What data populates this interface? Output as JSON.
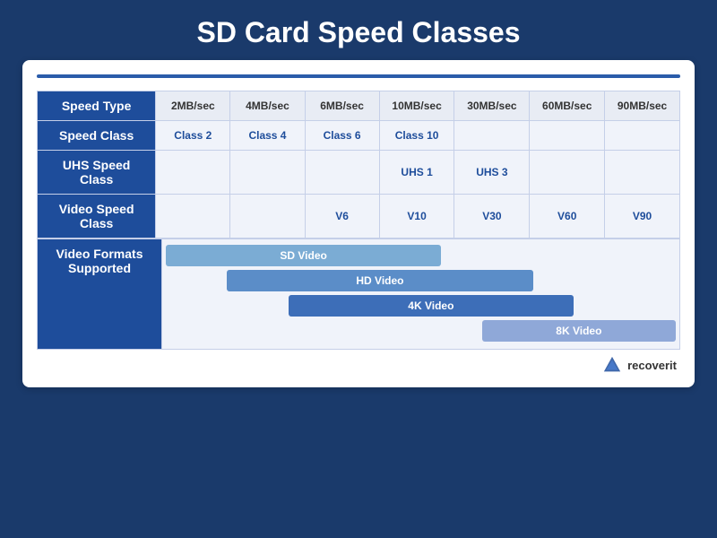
{
  "title": "SD Card Speed Classes",
  "table": {
    "header": {
      "label": "Speed Type",
      "cols": [
        "2MB/sec",
        "4MB/sec",
        "6MB/sec",
        "10MB/sec",
        "30MB/sec",
        "60MB/sec",
        "90MB/sec"
      ]
    },
    "rows": [
      {
        "label": "Speed Class",
        "cells": [
          "Class 2",
          "Class 4",
          "Class 6",
          "Class 10",
          "",
          "",
          ""
        ]
      },
      {
        "label": "UHS Speed Class",
        "cells": [
          "",
          "",
          "",
          "UHS 1",
          "UHS 3",
          "",
          ""
        ]
      },
      {
        "label": "Video Speed Class",
        "cells": [
          "",
          "",
          "V6",
          "V10",
          "V30",
          "V60",
          "V90"
        ]
      }
    ],
    "video_formats": {
      "label_line1": "Video Formats",
      "label_line2": "Supported",
      "bars": [
        {
          "label": "SD Video",
          "class": "sd-bar"
        },
        {
          "label": "HD Video",
          "class": "hd-bar"
        },
        {
          "label": "4K Video",
          "class": "fk-bar"
        },
        {
          "label": "8K Video",
          "class": "ek-bar"
        }
      ]
    }
  },
  "brand": {
    "name": "recoverit"
  }
}
